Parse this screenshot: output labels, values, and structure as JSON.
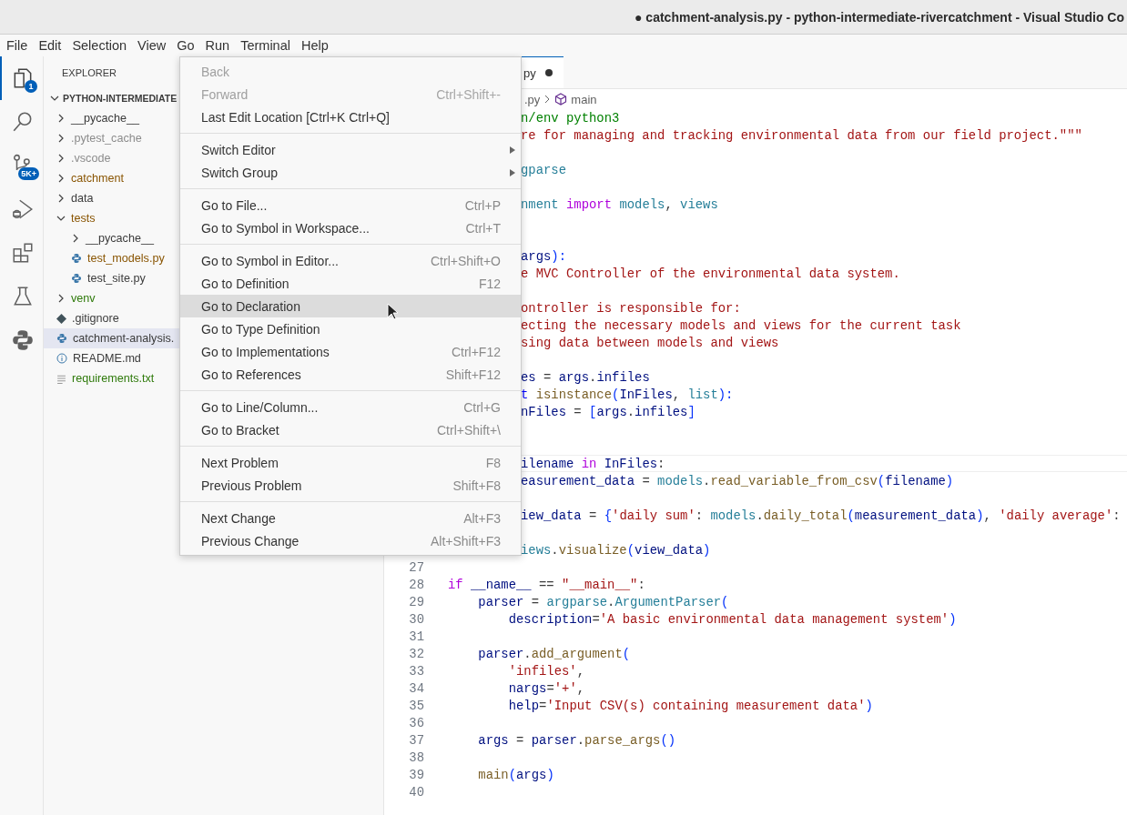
{
  "window": {
    "title": "● catchment-analysis.py - python-intermediate-rivercatchment - Visual Studio Co"
  },
  "menubar": [
    "File",
    "Edit",
    "Selection",
    "View",
    "Go",
    "Run",
    "Terminal",
    "Help"
  ],
  "activity_bar": [
    {
      "kind": "files",
      "selected": true,
      "badge": "1"
    },
    {
      "kind": "search",
      "selected": false
    },
    {
      "kind": "source-control",
      "selected": false,
      "badge": "5K+"
    },
    {
      "kind": "run-debug",
      "selected": false
    },
    {
      "kind": "extensions",
      "selected": false
    },
    {
      "kind": "testing",
      "selected": false
    },
    {
      "kind": "python",
      "selected": false
    }
  ],
  "sidebar": {
    "title": "EXPLORER",
    "root": {
      "label": "PYTHON-INTERMEDIATE",
      "expanded": true
    },
    "items": [
      {
        "label": "__pycache__",
        "kind": "folder",
        "expanded": false,
        "selected": false,
        "color": "#3b3b3b"
      },
      {
        "label": ".pytest_cache",
        "kind": "folder",
        "expanded": false,
        "selected": false,
        "color": "#8c8c8c"
      },
      {
        "label": ".vscode",
        "kind": "folder",
        "expanded": false,
        "selected": false,
        "color": "#8c8c8c"
      },
      {
        "label": "catchment",
        "kind": "folder",
        "expanded": false,
        "selected": false,
        "color": "#895503"
      },
      {
        "label": "data",
        "kind": "folder",
        "expanded": false,
        "selected": false,
        "color": "#3b3b3b"
      },
      {
        "label": "tests",
        "kind": "folder",
        "expanded": true,
        "selected": false,
        "color": "#895503",
        "children": [
          {
            "label": "__pycache__",
            "kind": "folder",
            "expanded": false,
            "selected": false,
            "color": "#3b3b3b"
          },
          {
            "label": "test_models.py",
            "kind": "python",
            "selected": false,
            "color": "#895503"
          },
          {
            "label": "test_site.py",
            "kind": "python",
            "selected": false,
            "color": "#3b3b3b"
          }
        ]
      },
      {
        "label": "venv",
        "kind": "folder",
        "expanded": false,
        "selected": false,
        "color": "#2f7a0b"
      },
      {
        "label": ".gitignore",
        "kind": "git",
        "selected": false,
        "color": "#3b3b3b"
      },
      {
        "label": "catchment-analysis.",
        "kind": "python",
        "selected": true,
        "color": "#3b3b3b"
      },
      {
        "label": "README.md",
        "kind": "info",
        "selected": false,
        "color": "#3b3b3b"
      },
      {
        "label": "requirements.txt",
        "kind": "text",
        "selected": false,
        "color": "#2f7a0b"
      }
    ]
  },
  "editor": {
    "tab": {
      "label": "py",
      "modified": true
    },
    "breadcrumb": {
      "file": ".py",
      "symbol": "main"
    },
    "lines": [
      {
        "current": false,
        "tokens": [
          {
            "text": "n/env python3",
            "kind": "comment"
          }
        ]
      },
      {
        "current": false,
        "tokens": [
          {
            "text": "re for managing and tracking environmental data from our field project.\"\"\"",
            "kind": "string"
          }
        ]
      },
      {
        "current": false
      },
      {
        "current": false,
        "tokens": [
          {
            "text": "gparse",
            "kind": "module"
          }
        ]
      },
      {
        "current": false
      },
      {
        "current": false,
        "tokens": [
          {
            "text": "nment",
            "kind": "module"
          },
          {
            "text": " import ",
            "kind": "control"
          },
          {
            "text": "models",
            "kind": "module"
          },
          {
            "text": ", ",
            "kind": "plain"
          },
          {
            "text": "views",
            "kind": "module"
          }
        ]
      },
      {
        "current": false
      },
      {
        "current": false
      },
      {
        "current": false,
        "tokens": [
          {
            "text": "args",
            "kind": "variable"
          },
          {
            "text": "):",
            "kind": "bracket"
          }
        ]
      },
      {
        "current": false,
        "tokens": [
          {
            "text": "e MVC Controller of the environmental data system.",
            "kind": "string"
          }
        ]
      },
      {
        "current": false
      },
      {
        "current": false,
        "tokens": [
          {
            "text": "ontroller is responsible for:",
            "kind": "string"
          }
        ]
      },
      {
        "current": false,
        "tokens": [
          {
            "text": "ecting the necessary models and views for the current task",
            "kind": "string"
          }
        ]
      },
      {
        "current": false,
        "tokens": [
          {
            "text": "sing data between models and views",
            "kind": "string"
          }
        ]
      },
      {
        "current": false
      },
      {
        "current": false,
        "tokens": [
          {
            "text": "es",
            "kind": "variable"
          },
          {
            "text": " = ",
            "kind": "plain"
          },
          {
            "text": "args",
            "kind": "variable"
          },
          {
            "text": ".",
            "kind": "plain"
          },
          {
            "text": "infiles",
            "kind": "variable"
          }
        ]
      },
      {
        "current": false,
        "tokens": [
          {
            "text": "t ",
            "kind": "keyword"
          },
          {
            "text": "isinstance",
            "kind": "function"
          },
          {
            "text": "(",
            "kind": "bracket"
          },
          {
            "text": "InFiles",
            "kind": "variable"
          },
          {
            "text": ", ",
            "kind": "plain"
          },
          {
            "text": "list",
            "kind": "module"
          },
          {
            "text": "):",
            "kind": "bracket"
          }
        ]
      },
      {
        "current": false,
        "tokens": [
          {
            "text": "nFiles",
            "kind": "variable"
          },
          {
            "text": " = ",
            "kind": "plain"
          },
          {
            "text": "[",
            "kind": "bracket"
          },
          {
            "text": "args",
            "kind": "variable"
          },
          {
            "text": ".",
            "kind": "plain"
          },
          {
            "text": "infiles",
            "kind": "variable"
          },
          {
            "text": "]",
            "kind": "bracket"
          }
        ]
      },
      {
        "current": false
      },
      {
        "current": false
      },
      {
        "current": true,
        "tokens": [
          {
            "text": "ilename",
            "kind": "variable"
          },
          {
            "text": " in ",
            "kind": "control"
          },
          {
            "text": "InFiles",
            "kind": "variable"
          },
          {
            "text": ":",
            "kind": "plain"
          }
        ]
      },
      {
        "current": false,
        "tokens": [
          {
            "text": "easurement_data",
            "kind": "variable"
          },
          {
            "text": " = ",
            "kind": "plain"
          },
          {
            "text": "models",
            "kind": "module"
          },
          {
            "text": ".",
            "kind": "plain"
          },
          {
            "text": "read_variable_from_csv",
            "kind": "function"
          },
          {
            "text": "(",
            "kind": "bracket"
          },
          {
            "text": "filename",
            "kind": "variable"
          },
          {
            "text": ")",
            "kind": "bracket"
          }
        ]
      },
      {
        "current": false
      },
      {
        "current": false,
        "tokens": [
          {
            "text": "iew_data",
            "kind": "variable"
          },
          {
            "text": " = ",
            "kind": "plain"
          },
          {
            "text": "{",
            "kind": "bracket"
          },
          {
            "text": "'daily sum'",
            "kind": "string"
          },
          {
            "text": ": ",
            "kind": "plain"
          },
          {
            "text": "models",
            "kind": "module"
          },
          {
            "text": ".",
            "kind": "plain"
          },
          {
            "text": "daily_total",
            "kind": "function"
          },
          {
            "text": "(",
            "kind": "bracket"
          },
          {
            "text": "measurement_data",
            "kind": "variable"
          },
          {
            "text": ")",
            "kind": "bracket"
          },
          {
            "text": ", ",
            "kind": "plain"
          },
          {
            "text": "'daily average'",
            "kind": "string"
          },
          {
            "text": ":",
            "kind": "plain"
          }
        ]
      },
      {
        "current": false
      },
      {
        "current": false,
        "tokens": [
          {
            "text": "iews",
            "kind": "module"
          },
          {
            "text": ".",
            "kind": "plain"
          },
          {
            "text": "visualize",
            "kind": "function"
          },
          {
            "text": "(",
            "kind": "bracket"
          },
          {
            "text": "view_data",
            "kind": "variable"
          },
          {
            "text": ")",
            "kind": "bracket"
          }
        ]
      },
      {
        "number": "27",
        "current": false
      },
      {
        "number": "28",
        "current": false,
        "tokens": [
          {
            "text": "if",
            "kind": "control"
          },
          {
            "text": " __name__",
            "kind": "variable"
          },
          {
            "text": " == ",
            "kind": "plain"
          },
          {
            "text": "\"__main__\"",
            "kind": "string"
          },
          {
            "text": ":",
            "kind": "plain"
          }
        ]
      },
      {
        "number": "29",
        "current": false,
        "tokens": [
          {
            "text": "    parser",
            "kind": "variable"
          },
          {
            "text": " = ",
            "kind": "plain"
          },
          {
            "text": "argparse",
            "kind": "module"
          },
          {
            "text": ".",
            "kind": "plain"
          },
          {
            "text": "ArgumentParser",
            "kind": "module"
          },
          {
            "text": "(",
            "kind": "bracket"
          }
        ]
      },
      {
        "number": "30",
        "current": false,
        "tokens": [
          {
            "text": "        description",
            "kind": "variable"
          },
          {
            "text": "=",
            "kind": "plain"
          },
          {
            "text": "'A basic environmental data management system'",
            "kind": "string"
          },
          {
            "text": ")",
            "kind": "bracket"
          }
        ]
      },
      {
        "number": "31",
        "current": false
      },
      {
        "number": "32",
        "current": false,
        "tokens": [
          {
            "text": "    parser",
            "kind": "variable"
          },
          {
            "text": ".",
            "kind": "plain"
          },
          {
            "text": "add_argument",
            "kind": "function"
          },
          {
            "text": "(",
            "kind": "bracket"
          }
        ]
      },
      {
        "number": "33",
        "current": false,
        "tokens": [
          {
            "text": "        'infiles'",
            "kind": "string"
          },
          {
            "text": ",",
            "kind": "plain"
          }
        ]
      },
      {
        "number": "34",
        "current": false,
        "tokens": [
          {
            "text": "        nargs",
            "kind": "variable"
          },
          {
            "text": "=",
            "kind": "plain"
          },
          {
            "text": "'+'",
            "kind": "string"
          },
          {
            "text": ",",
            "kind": "plain"
          }
        ]
      },
      {
        "number": "35",
        "current": false,
        "tokens": [
          {
            "text": "        help",
            "kind": "variable"
          },
          {
            "text": "=",
            "kind": "plain"
          },
          {
            "text": "'Input CSV(s) containing measurement data'",
            "kind": "string"
          },
          {
            "text": ")",
            "kind": "bracket"
          }
        ]
      },
      {
        "number": "36",
        "current": false
      },
      {
        "number": "37",
        "current": false,
        "tokens": [
          {
            "text": "    args",
            "kind": "variable"
          },
          {
            "text": " = ",
            "kind": "plain"
          },
          {
            "text": "parser",
            "kind": "variable"
          },
          {
            "text": ".",
            "kind": "plain"
          },
          {
            "text": "parse_args",
            "kind": "function"
          },
          {
            "text": "()",
            "kind": "bracket"
          }
        ]
      },
      {
        "number": "38",
        "current": false
      },
      {
        "number": "39",
        "current": false,
        "tokens": [
          {
            "text": "    main",
            "kind": "function"
          },
          {
            "text": "(",
            "kind": "bracket"
          },
          {
            "text": "args",
            "kind": "variable"
          },
          {
            "text": ")",
            "kind": "bracket"
          }
        ]
      },
      {
        "number": "40",
        "current": false
      }
    ]
  },
  "go_menu": [
    {
      "kind": "item",
      "label": "Back",
      "disabled": true,
      "selected": false,
      "submenu": false
    },
    {
      "kind": "item",
      "label": "Forward",
      "shortcut": "Ctrl+Shift+-",
      "disabled": true,
      "selected": false,
      "submenu": false
    },
    {
      "kind": "item",
      "label": "Last Edit Location [Ctrl+K Ctrl+Q]",
      "disabled": false,
      "selected": false,
      "submenu": false
    },
    {
      "kind": "separator"
    },
    {
      "kind": "item",
      "label": "Switch Editor",
      "disabled": false,
      "selected": false,
      "submenu": true
    },
    {
      "kind": "item",
      "label": "Switch Group",
      "disabled": false,
      "selected": false,
      "submenu": true
    },
    {
      "kind": "separator"
    },
    {
      "kind": "item",
      "label": "Go to File...",
      "shortcut": "Ctrl+P",
      "disabled": false,
      "selected": false,
      "submenu": false
    },
    {
      "kind": "item",
      "label": "Go to Symbol in Workspace...",
      "shortcut": "Ctrl+T",
      "disabled": false,
      "selected": false,
      "submenu": false
    },
    {
      "kind": "separator"
    },
    {
      "kind": "item",
      "label": "Go to Symbol in Editor...",
      "shortcut": "Ctrl+Shift+O",
      "disabled": false,
      "selected": false,
      "submenu": false
    },
    {
      "kind": "item",
      "label": "Go to Definition",
      "shortcut": "F12",
      "disabled": false,
      "selected": false,
      "submenu": false
    },
    {
      "kind": "item",
      "label": "Go to Declaration",
      "disabled": false,
      "selected": true,
      "submenu": false
    },
    {
      "kind": "item",
      "label": "Go to Type Definition",
      "disabled": false,
      "selected": false,
      "submenu": false
    },
    {
      "kind": "item",
      "label": "Go to Implementations",
      "shortcut": "Ctrl+F12",
      "disabled": false,
      "selected": false,
      "submenu": false
    },
    {
      "kind": "item",
      "label": "Go to References",
      "shortcut": "Shift+F12",
      "disabled": false,
      "selected": false,
      "submenu": false
    },
    {
      "kind": "separator"
    },
    {
      "kind": "item",
      "label": "Go to Line/Column...",
      "shortcut": "Ctrl+G",
      "disabled": false,
      "selected": false,
      "submenu": false
    },
    {
      "kind": "item",
      "label": "Go to Bracket",
      "shortcut": "Ctrl+Shift+\\",
      "disabled": false,
      "selected": false,
      "submenu": false
    },
    {
      "kind": "separator"
    },
    {
      "kind": "item",
      "label": "Next Problem",
      "shortcut": "F8",
      "disabled": false,
      "selected": false,
      "submenu": false
    },
    {
      "kind": "item",
      "label": "Previous Problem",
      "shortcut": "Shift+F8",
      "disabled": false,
      "selected": false,
      "submenu": false
    },
    {
      "kind": "separator"
    },
    {
      "kind": "item",
      "label": "Next Change",
      "shortcut": "Alt+F3",
      "disabled": false,
      "selected": false,
      "submenu": false
    },
    {
      "kind": "item",
      "label": "Previous Change",
      "shortcut": "Alt+Shift+F3",
      "disabled": false,
      "selected": false,
      "submenu": false
    }
  ]
}
